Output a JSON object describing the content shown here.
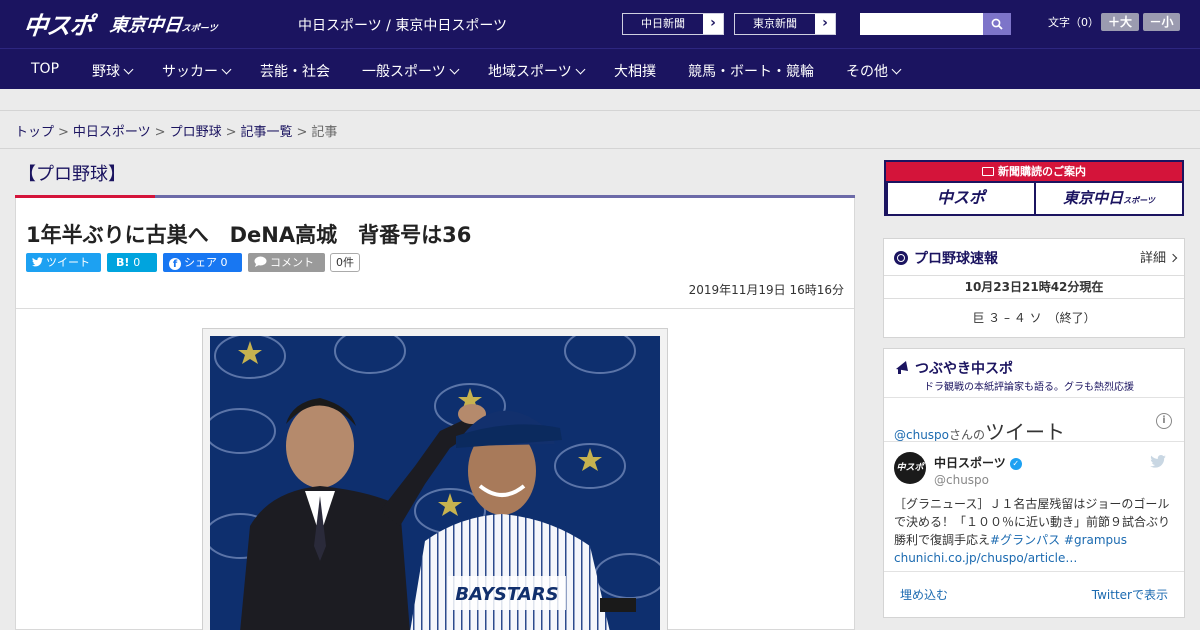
{
  "header": {
    "logo_main": "中スポ",
    "logo_sub": "東京中日",
    "logo_sub_small": "スポーツ",
    "site_names": "中日スポーツ / 東京中日スポーツ",
    "links": [
      {
        "label": "中日新聞"
      },
      {
        "label": "東京新聞"
      }
    ],
    "search": {
      "placeholder": "",
      "icon": "search-icon"
    },
    "font_size": {
      "label": "文字（0）",
      "increase": "＋大",
      "decrease": "－小"
    }
  },
  "nav": {
    "items": [
      {
        "label": "TOP",
        "dropdown": false
      },
      {
        "label": "野球",
        "dropdown": true
      },
      {
        "label": "サッカー",
        "dropdown": true
      },
      {
        "label": "芸能・社会",
        "dropdown": false
      },
      {
        "label": "一般スポーツ",
        "dropdown": true
      },
      {
        "label": "地域スポーツ",
        "dropdown": true
      },
      {
        "label": "大相撲",
        "dropdown": false
      },
      {
        "label": "競馬・ボート・競輪",
        "dropdown": false
      },
      {
        "label": "その他",
        "dropdown": true
      }
    ]
  },
  "breadcrumb": {
    "items": [
      "トップ",
      "中日スポーツ",
      "プロ野球",
      "記事一覧"
    ],
    "current": "記事",
    "separator": ">"
  },
  "article": {
    "category": "【プロ野球】",
    "headline": "1年半ぶりに古巣へ　DeNA高城　背番号は36",
    "share": {
      "tweet": "ツイート",
      "hatena": "B!",
      "hatena_count": "0",
      "facebook": "シェア",
      "facebook_count": "0",
      "comment": "コメント",
      "comment_count": "0件"
    },
    "date": "2019年11月19日 16時16分"
  },
  "sidebar": {
    "banner": {
      "strip_text": "新聞購読のご案内",
      "left": "中スポ",
      "right": "東京中日",
      "right_small": "スポーツ"
    },
    "scores": {
      "title": "プロ野球速報",
      "detail_link": "詳細",
      "timestamp": "10月23日21時42分現在",
      "result": "巨 ３ – ４ ソ　（終了）"
    },
    "tweets": {
      "title": "つぶやき中スポ",
      "subtitle": "ドラ観戦の本紙評論家も語る。グラも熱烈応援",
      "head_user": "@chuspo",
      "head_suffix": "さんの",
      "head_label": "ツイート",
      "tweet": {
        "name": "中日スポーツ",
        "handle": "@chuspo",
        "avatar_text": "中スポ",
        "text_plain": "［グラニュース］Ｊ１名古屋残留はジョーのゴールで決める！「１００％に近い動き」前節９試合ぶり勝利で復調手応え",
        "hashtag1": "#グランパス",
        "hashtag2": "#grampus",
        "link": "chunichi.co.jp/chuspo/article…"
      },
      "embed": "埋め込む",
      "view_on": "Twitterで表示"
    }
  },
  "colors": {
    "brand_navy": "#1b1460",
    "accent_red": "#d4143a",
    "twitter": "#1da1f2",
    "facebook": "#1877f2"
  }
}
